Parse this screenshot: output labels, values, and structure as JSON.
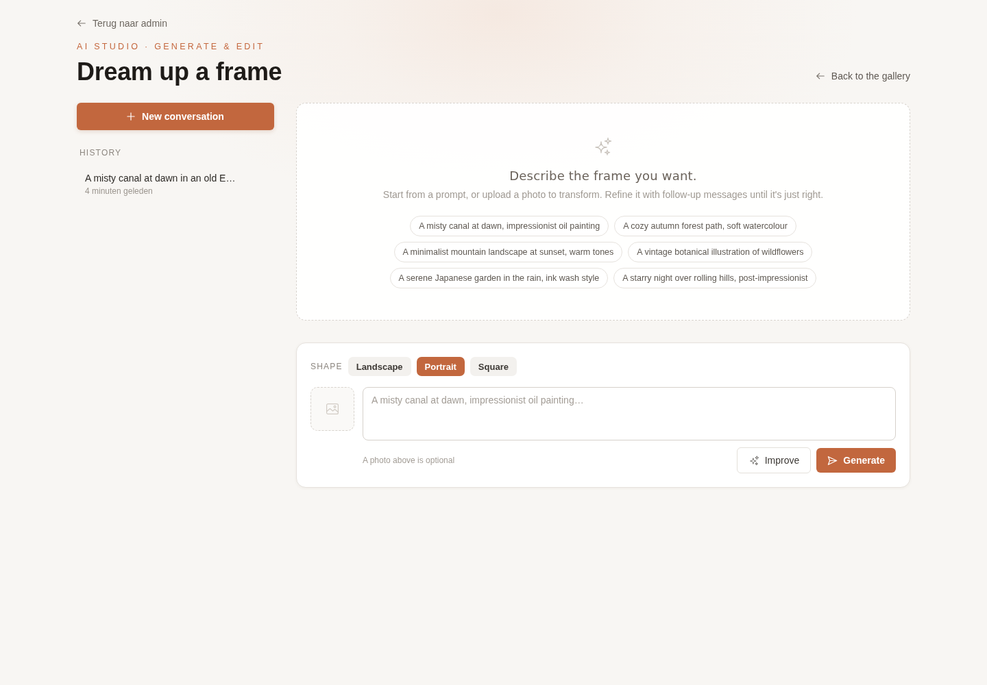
{
  "back_link": "Terug naar admin",
  "header": {
    "eyebrow": "AI STUDIO · GENERATE & EDIT",
    "title": "Dream up a frame",
    "gallery_link": "Back to the gallery"
  },
  "sidebar": {
    "new_conversation": "New conversation",
    "history_heading": "HISTORY",
    "history": [
      {
        "title": "A misty canal at dawn in an old E…",
        "time": "4 minuten geleden",
        "selected": false
      }
    ]
  },
  "empty_state": {
    "heading": "Describe the frame you want.",
    "description": "Start from a prompt, or upload a photo to transform. Refine it with follow-up messages until it's just right.",
    "suggestions": [
      "A misty canal at dawn, impressionist oil painting",
      "A cozy autumn forest path, soft watercolour",
      "A minimalist mountain landscape at sunset, warm tones",
      "A vintage botanical illustration of wildflowers",
      "A serene Japanese garden in the rain, ink wash style",
      "A starry night over rolling hills, post-impressionist"
    ]
  },
  "composer": {
    "shape_label": "SHAPE",
    "shapes": [
      {
        "label": "Landscape",
        "selected": false
      },
      {
        "label": "Portrait",
        "selected": true
      },
      {
        "label": "Square",
        "selected": false
      }
    ],
    "prompt": {
      "placeholder": "A misty canal at dawn, impressionist oil painting…"
    },
    "hint": "A photo above is optional",
    "buttons": [
      {
        "label": "Improve",
        "kind": "secondary"
      },
      {
        "label": "Generate",
        "kind": "primary"
      }
    ]
  }
}
